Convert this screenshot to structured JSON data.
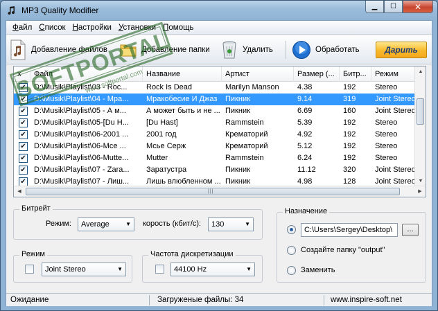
{
  "window": {
    "title": "MP3 Quality Modifier",
    "icon": "music-note-icon"
  },
  "menu": [
    {
      "label": "Файл",
      "key": "Ф",
      "rest": "айл"
    },
    {
      "label": "Список",
      "key": "С",
      "rest": "писок"
    },
    {
      "label": "Настройки",
      "key": "Н",
      "rest": "астройки"
    },
    {
      "label": "Установки",
      "key": "У",
      "rest": "становки"
    },
    {
      "label": "Помощь",
      "key": "П",
      "rest": "омощь"
    }
  ],
  "toolbar": {
    "add_files": "Добавление файлов",
    "add_folder": "Добавление папки",
    "delete": "Удалить",
    "process": "Обработать",
    "donate": "Дарить"
  },
  "list": {
    "columns": [
      "x",
      "Файл",
      "Название",
      "Артист",
      "Размер (...",
      "Битр...",
      "Режим"
    ],
    "rows": [
      {
        "checked": true,
        "file": "D:\\Musik\\Playlist\\03 - Roc...",
        "title": "Rock Is Dead",
        "artist": "Marilyn Manson",
        "size": "4.38",
        "bitrate": "192",
        "mode": "Stereo",
        "selected": false
      },
      {
        "checked": true,
        "file": "D:\\Musik\\Playlist\\04 - Мра...",
        "title": "Мракобесие И Джаз",
        "artist": "Пикник",
        "size": "9.14",
        "bitrate": "319",
        "mode": "Joint Stereo",
        "selected": true
      },
      {
        "checked": true,
        "file": "D:\\Musik\\Playlist\\05 - А м...",
        "title": "А может быть и не ...",
        "artist": "Пикник",
        "size": "6.69",
        "bitrate": "160",
        "mode": "Joint Stereo",
        "selected": false
      },
      {
        "checked": true,
        "file": "D:\\Musik\\Playlist\\05-[Du H...",
        "title": "[Du Hast]",
        "artist": "Rammstein",
        "size": "5.39",
        "bitrate": "192",
        "mode": "Stereo",
        "selected": false
      },
      {
        "checked": true,
        "file": "D:\\Musik\\Playlist\\06-2001 ...",
        "title": "2001 год",
        "artist": "Крематорий",
        "size": "4.92",
        "bitrate": "192",
        "mode": "Stereo",
        "selected": false
      },
      {
        "checked": true,
        "file": "D:\\Musik\\Playlist\\06-Мсе ...",
        "title": "Мсье Серж",
        "artist": "Крематорий",
        "size": "5.12",
        "bitrate": "192",
        "mode": "Stereo",
        "selected": false
      },
      {
        "checked": true,
        "file": "D:\\Musik\\Playlist\\06-Mutte...",
        "title": "Mutter",
        "artist": "Rammstein",
        "size": "6.24",
        "bitrate": "192",
        "mode": "Stereo",
        "selected": false
      },
      {
        "checked": true,
        "file": "D:\\Musik\\Playlist\\07 - Zara...",
        "title": "Заратустра",
        "artist": "Пикник",
        "size": "11.12",
        "bitrate": "320",
        "mode": "Joint Stereo",
        "selected": false
      },
      {
        "checked": true,
        "file": "D:\\Musik\\Playlist\\07 - Лиш...",
        "title": "Лишь влюбленном ...",
        "artist": "Пикник",
        "size": "4.98",
        "bitrate": "128",
        "mode": "Joint Stereo",
        "selected": false
      }
    ]
  },
  "bitrate_group": {
    "title": "Битрейт",
    "mode_label": "Режим:",
    "mode_value": "Average",
    "speed_label": "корость (кбит/с):",
    "speed_value": "130"
  },
  "mode_group": {
    "title": "Режим",
    "value": "Joint Stereo"
  },
  "sample_group": {
    "title": "Частота дискретизации",
    "value": "44100 Hz"
  },
  "dest_group": {
    "title": "Назначение",
    "path": "C:\\Users\\Sergey\\Desktop\\",
    "browse": "...",
    "create_folder": "Создайте папку \"output\"",
    "replace": "Заменить",
    "selected": "path"
  },
  "status": {
    "state": "Ожидание",
    "loaded": "Загруженые файлы: 34",
    "site": "www.inspire-soft.net"
  },
  "watermark": {
    "text": "SOFTPORTAL",
    "url": "www.softportal.com",
    "color": "#2d6b2a"
  },
  "colors": {
    "selection": "#3399ff",
    "donate": "#f7b92a"
  }
}
